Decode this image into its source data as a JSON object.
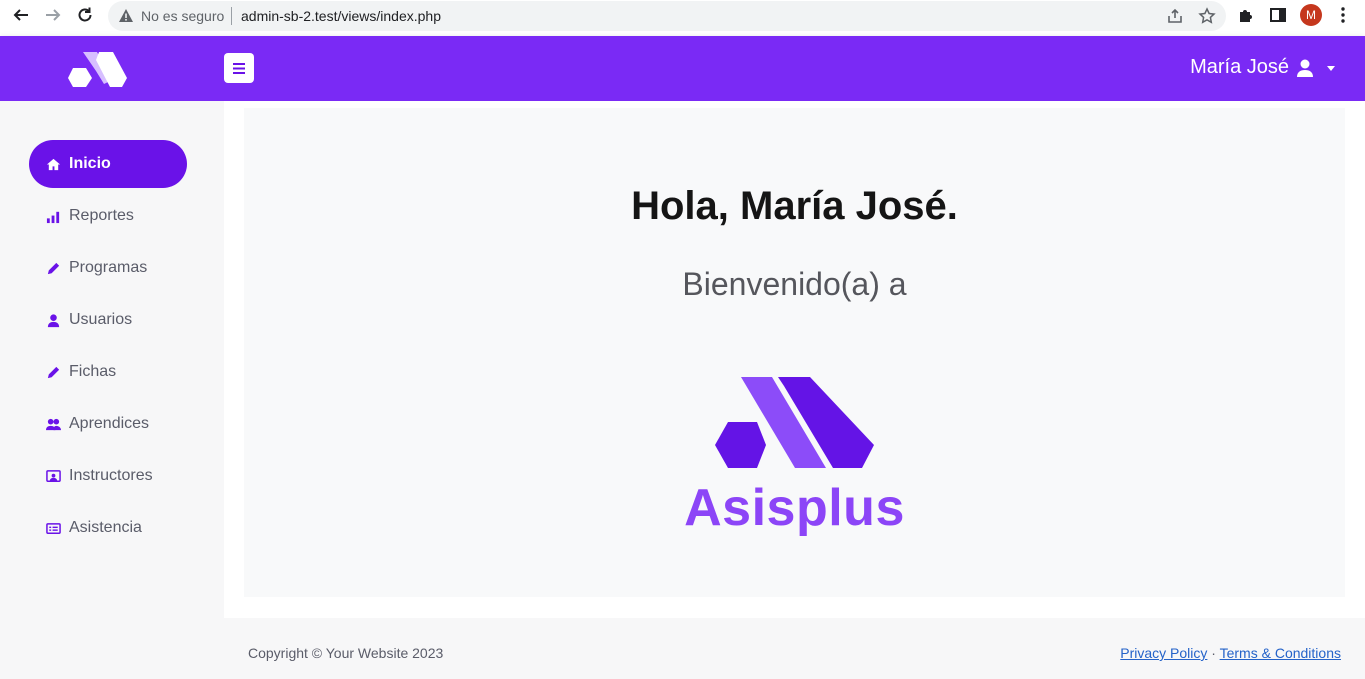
{
  "browser": {
    "security_label": "No es seguro",
    "url": "admin-sb-2.test/views/index.php",
    "profile_initial": "M"
  },
  "topbar": {
    "user_name": "María José"
  },
  "sidebar": {
    "items": [
      {
        "label": "Inicio",
        "icon": "home-icon",
        "active": true
      },
      {
        "label": "Reportes",
        "icon": "bar-chart-icon"
      },
      {
        "label": "Programas",
        "icon": "pencil-icon"
      },
      {
        "label": "Usuarios",
        "icon": "user-icon"
      },
      {
        "label": "Fichas",
        "icon": "pencil-icon"
      },
      {
        "label": "Aprendices",
        "icon": "users-icon"
      },
      {
        "label": "Instructores",
        "icon": "chalkboard-teacher-icon"
      },
      {
        "label": "Asistencia",
        "icon": "id-card-icon"
      }
    ]
  },
  "main": {
    "greeting": "Hola, María José.",
    "welcome": "Bienvenido(a) a",
    "brand_name": "Asisplus"
  },
  "footer": {
    "copyright": "Copyright © Your Website 2023",
    "privacy": "Privacy Policy",
    "separator": "·",
    "terms": "Terms & Conditions"
  },
  "colors": {
    "topbar": "#7a2af5",
    "accent": "#6a12e8",
    "brand_text": "#8c45f7",
    "logo_dark": "#6414e6",
    "logo_light": "#8c4cf9"
  }
}
